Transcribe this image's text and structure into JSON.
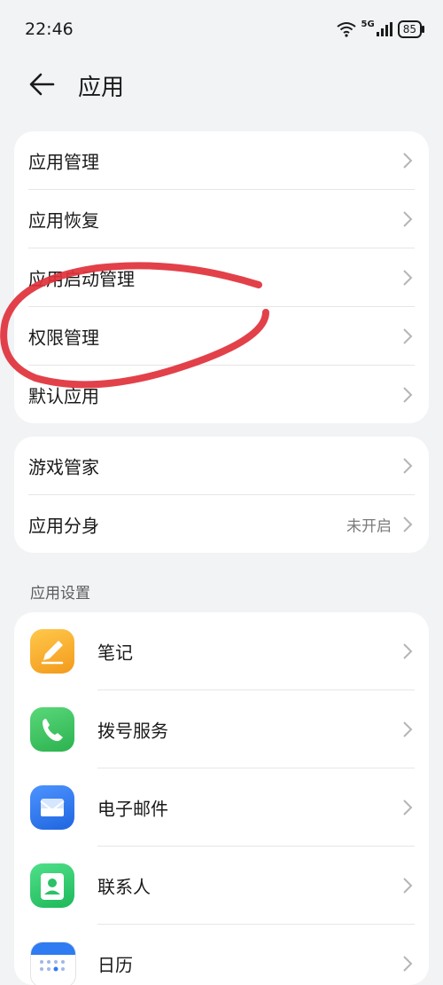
{
  "status_bar": {
    "time": "22:46",
    "network": "5G",
    "battery": "85"
  },
  "header": {
    "title": "应用"
  },
  "group1": {
    "items": [
      {
        "label": "应用管理"
      },
      {
        "label": "应用恢复"
      },
      {
        "label": "应用启动管理"
      },
      {
        "label": "权限管理"
      },
      {
        "label": "默认应用"
      }
    ]
  },
  "group2": {
    "items": [
      {
        "label": "游戏管家",
        "value": ""
      },
      {
        "label": "应用分身",
        "value": "未开启"
      }
    ]
  },
  "app_settings": {
    "section_label": "应用设置",
    "items": [
      {
        "label": "笔记",
        "icon": "notes-icon"
      },
      {
        "label": "拨号服务",
        "icon": "phone-icon"
      },
      {
        "label": "电子邮件",
        "icon": "email-icon"
      },
      {
        "label": "联系人",
        "icon": "contacts-icon"
      },
      {
        "label": "日历",
        "icon": "calendar-icon"
      }
    ]
  },
  "colors": {
    "annotation": "#e0313b",
    "notes": "#f5a623",
    "phone": "#35c65a",
    "email": "#2f7bf2",
    "contacts": "#2ec866",
    "calendar": "#2f7bf2"
  }
}
